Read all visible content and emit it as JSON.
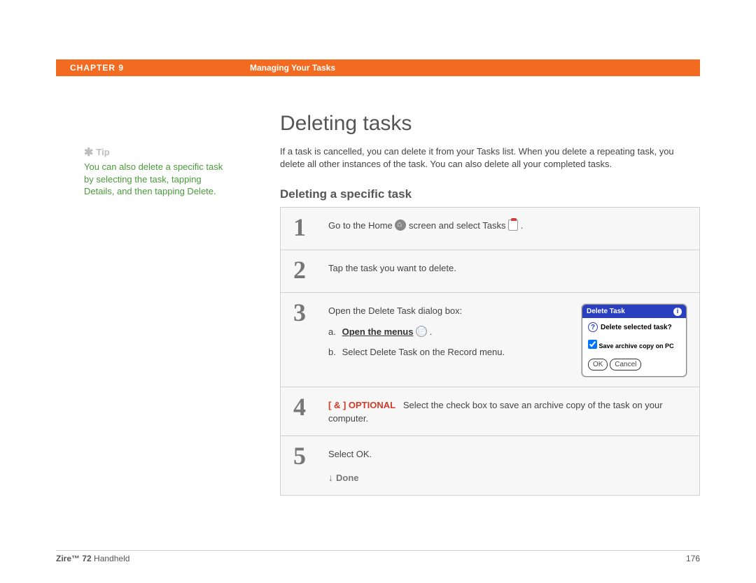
{
  "header": {
    "chapter_label": "CHAPTER 9",
    "chapter_title": "Managing Your Tasks"
  },
  "sidebar": {
    "tip_label": "Tip",
    "tip_text": "You can also delete a specific task by selecting the task, tapping Details, and then tapping Delete."
  },
  "main": {
    "h1": "Deleting tasks",
    "intro": "If a task is cancelled, you can delete it from your Tasks list. When you delete a repeating task, you delete all other instances of the task. You can also delete all your completed tasks.",
    "h2": "Deleting a specific task"
  },
  "steps": [
    {
      "num": "1",
      "text_before": "Go to the Home ",
      "text_mid": " screen and select Tasks ",
      "text_after": " ."
    },
    {
      "num": "2",
      "text": "Tap the task you want to delete."
    },
    {
      "num": "3",
      "intro": "Open the Delete Task dialog box:",
      "sub_a_label": "a.",
      "sub_a_link": "Open the menus",
      "sub_a_after": " .",
      "sub_b_label": "b.",
      "sub_b_text": "Select Delete Task on the Record menu."
    },
    {
      "num": "4",
      "optional_label": "[ & ]  OPTIONAL",
      "text": "Select the check box to save an archive copy of the task on your computer."
    },
    {
      "num": "5",
      "text": "Select OK.",
      "done": "Done"
    }
  ],
  "dialog": {
    "title": "Delete Task",
    "question": "Delete selected task?",
    "checkbox": "Save archive copy on PC",
    "ok": "OK",
    "cancel": "Cancel"
  },
  "footer": {
    "product_bold": "Zire™ 72",
    "product_rest": " Handheld",
    "page": "176"
  }
}
